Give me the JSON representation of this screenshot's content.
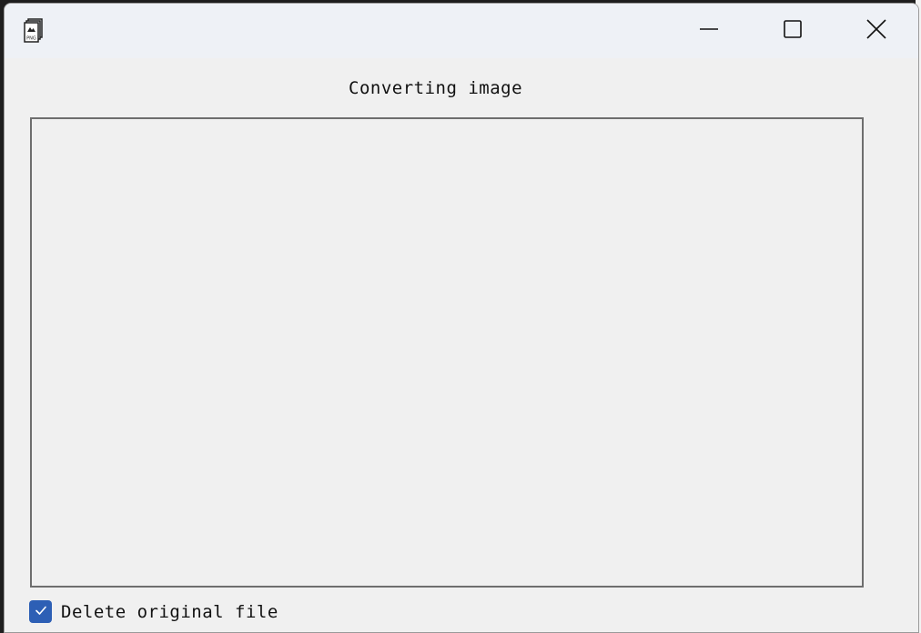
{
  "window": {
    "title": "",
    "controls": {
      "minimize_icon": "minimize-icon",
      "maximize_icon": "maximize-icon",
      "close_icon": "close-icon"
    }
  },
  "app_icon": {
    "name": "png-file-icon",
    "text": "PNG"
  },
  "main": {
    "heading": "Converting image"
  },
  "options": {
    "delete_original": {
      "label": "Delete original file",
      "checked": true
    }
  },
  "colors": {
    "accent": "#2d5fb5",
    "titlebar": "#eef1f6",
    "window_bg": "#f0f0f0",
    "frame_border": "#6e6e6e"
  }
}
